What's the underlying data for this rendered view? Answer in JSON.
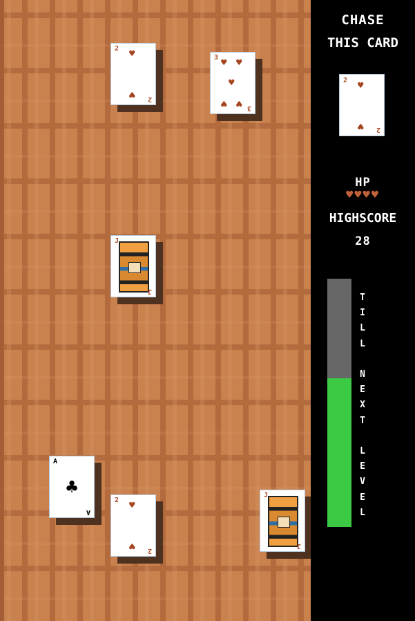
{
  "panel": {
    "title_line1": "CHASE",
    "title_line2": "THIS CARD",
    "target_card": {
      "rank": "2",
      "suit": "heart"
    },
    "hp_label": "HP",
    "hp": 4,
    "hp_max": 4,
    "highscore_label": "HIGHSCORE",
    "highscore": "28",
    "level_progress": 0.6,
    "level_label": [
      "T",
      "I",
      "L",
      "L",
      " ",
      "N",
      "E",
      "X",
      "T",
      " ",
      "L",
      "E",
      "V",
      "E",
      "L"
    ]
  },
  "cards": [
    {
      "id": "card-2h-a",
      "rank": "2",
      "suit": "heart"
    },
    {
      "id": "card-3h",
      "rank": "3",
      "suit": "heart"
    },
    {
      "id": "card-jack-1",
      "rank": "J",
      "suit": "heart"
    },
    {
      "id": "card-ace-club",
      "rank": "A",
      "suit": "club"
    },
    {
      "id": "card-2h-b",
      "rank": "2",
      "suit": "heart"
    },
    {
      "id": "card-jack-2",
      "rank": "J",
      "suit": "heart"
    }
  ],
  "colors": {
    "heart": "#a5451f",
    "club": "#000000",
    "bar_fill": "#3cc944",
    "bar_empty": "#676767",
    "wood": "#c9814e"
  }
}
